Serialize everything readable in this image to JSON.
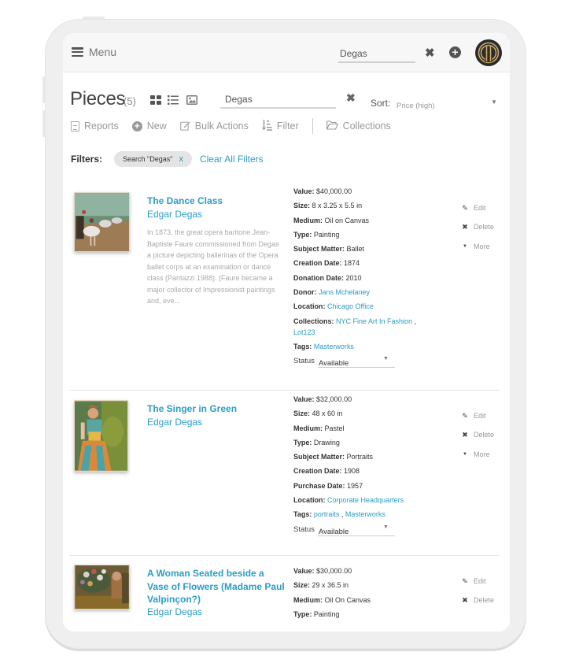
{
  "topbar": {
    "menu_label": "Menu",
    "search_value": "Degas",
    "clear_icon": "times-icon",
    "add_icon": "plus-circle-icon",
    "logo": "brand-logo",
    "brand_colors": {
      "logo_bg": "#2b2b2b",
      "logo_gold": "#c9a96a"
    }
  },
  "header": {
    "title": "Pieces",
    "count": "(5)",
    "views": [
      "grid-view-icon",
      "list-view-icon",
      "image-view-icon"
    ],
    "search_value": "Degas",
    "sort_label": "Sort:",
    "sort_value": "Price (high)"
  },
  "toolbar": {
    "reports": "Reports",
    "new": "New",
    "bulk_actions": "Bulk Actions",
    "filter": "Filter",
    "collections": "Collections"
  },
  "filters": {
    "label": "Filters:",
    "chips": [
      {
        "text": "Search \"Degas\"",
        "remove": "x"
      }
    ],
    "clear_all": "Clear All Filters"
  },
  "accent_color": "#2a9dc5",
  "items": [
    {
      "title": "The Dance Class",
      "artist": "Edgar Degas",
      "description": "In 1873, the great opera baritone Jean-Baptiste Faure commissioned from Degas a picture depicting ballerinas of the Opera ballet corps at an examination or dance class (Pantazzi 1988). (Faure became a major collector of Impressionist paintings and, eve...",
      "fields": {
        "value": {
          "label": "Value:",
          "text": "$40,000.00"
        },
        "size": {
          "label": "Size:",
          "text": "8 x 3.25 x 5.5 in"
        },
        "medium": {
          "label": "Medium:",
          "text": "Oil on Canvas"
        },
        "type": {
          "label": "Type:",
          "text": "Painting"
        },
        "subject": {
          "label": "Subject Matter:",
          "text": "Ballet"
        },
        "creation": {
          "label": "Creation Date:",
          "text": "1874"
        },
        "donation": {
          "label": "Donation Date:",
          "text": "2010"
        },
        "donor": {
          "label": "Donor:",
          "text": "Jans Mchelaney"
        },
        "location": {
          "label": "Location:",
          "text": "Chicago Office"
        },
        "collections": {
          "label": "Collections:",
          "links": [
            "NYC Fine Art In Fashion",
            "Lot123"
          ]
        },
        "tags": {
          "label": "Tags:",
          "links": [
            "Masterworks"
          ]
        }
      },
      "status_label": "Status",
      "status_value": "Available",
      "actions": {
        "edit": "Edit",
        "delete": "Delete",
        "more": "More"
      }
    },
    {
      "title": "The Singer in Green",
      "artist": "Edgar Degas",
      "fields": {
        "value": {
          "label": "Value:",
          "text": "$32,000.00"
        },
        "size": {
          "label": "Size:",
          "text": "48 x 60 in"
        },
        "medium": {
          "label": "Medium:",
          "text": "Pastel"
        },
        "type": {
          "label": "Type:",
          "text": "Drawing"
        },
        "subject": {
          "label": "Subject Matter:",
          "text": "Portraits"
        },
        "creation": {
          "label": "Creation Date:",
          "text": "1908"
        },
        "purchase": {
          "label": "Purchase Date:",
          "text": "1957"
        },
        "location": {
          "label": "Location:",
          "text": "Corporate Headquarters"
        },
        "tags": {
          "label": "Tags:",
          "links": [
            "portraits",
            "Masterworks"
          ]
        }
      },
      "status_label": "Status",
      "status_value": "Available",
      "actions": {
        "edit": "Edit",
        "delete": "Delete",
        "more": "More"
      }
    },
    {
      "title": "A Woman Seated beside a Vase of Flowers (Madame Paul Valpinçon?)",
      "artist": "Edgar Degas",
      "fields": {
        "value": {
          "label": "Value:",
          "text": "$30,000.00"
        },
        "size": {
          "label": "Size:",
          "text": "29 x 36.5 in"
        },
        "medium": {
          "label": "Medium:",
          "text": "Oil On Canvas"
        },
        "type": {
          "label": "Type:",
          "text": "Painting"
        }
      },
      "actions": {
        "edit": "Edit",
        "delete": "Delete"
      }
    }
  ],
  "separator": ","
}
